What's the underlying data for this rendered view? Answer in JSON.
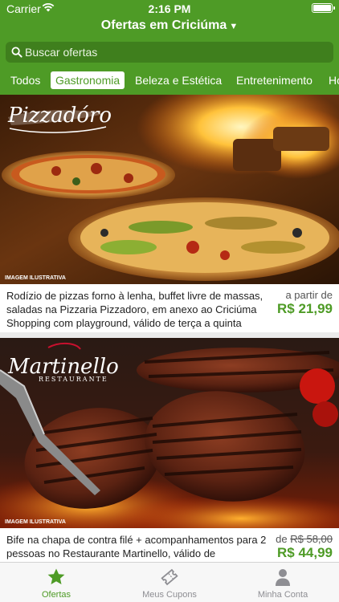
{
  "status_bar": {
    "carrier": "Carrier",
    "time": "2:16 PM"
  },
  "header": {
    "title": "Ofertas em Criciúma",
    "caret": "▼"
  },
  "search": {
    "placeholder": "Buscar ofertas"
  },
  "tabs": [
    {
      "label": "Todos",
      "active": false
    },
    {
      "label": "Gastronomia",
      "active": true
    },
    {
      "label": "Beleza e Estética",
      "active": false
    },
    {
      "label": "Entretenimento",
      "active": false
    },
    {
      "label": "Ho",
      "active": false
    }
  ],
  "offers": [
    {
      "logo_text": "Pizzadóro",
      "image_note": "IMAGEM ILUSTRATIVA",
      "description": "Rodízio de pizzas forno à lenha, buffet livre de massas, saladas na Pizzaria Pizzadoro, em anexo ao Criciúma Shopping com playground, válido de terça a quinta",
      "price_prefix": "a partir de",
      "price": "R$ 21,99"
    },
    {
      "logo_text": "Martinello",
      "logo_subtext": "RESTAURANTE",
      "image_note": "IMAGEM ILUSTRATIVA",
      "description": "Bife na chapa de contra filé + acompanhamentos para 2 pessoas no Restaurante Martinello, válido de",
      "price_prefix": "de",
      "old_price": "R$ 58,00",
      "price": "R$ 44,99"
    }
  ],
  "tab_bar": [
    {
      "label": "Ofertas",
      "icon": "star-icon",
      "active": true
    },
    {
      "label": "Meus Cupons",
      "icon": "ticket-icon",
      "active": false
    },
    {
      "label": "Minha Conta",
      "icon": "person-icon",
      "active": false
    }
  ],
  "colors": {
    "brand_green": "#4e9b26",
    "search_bg": "#3f7f1d",
    "inactive_gray": "#8e8e93"
  }
}
